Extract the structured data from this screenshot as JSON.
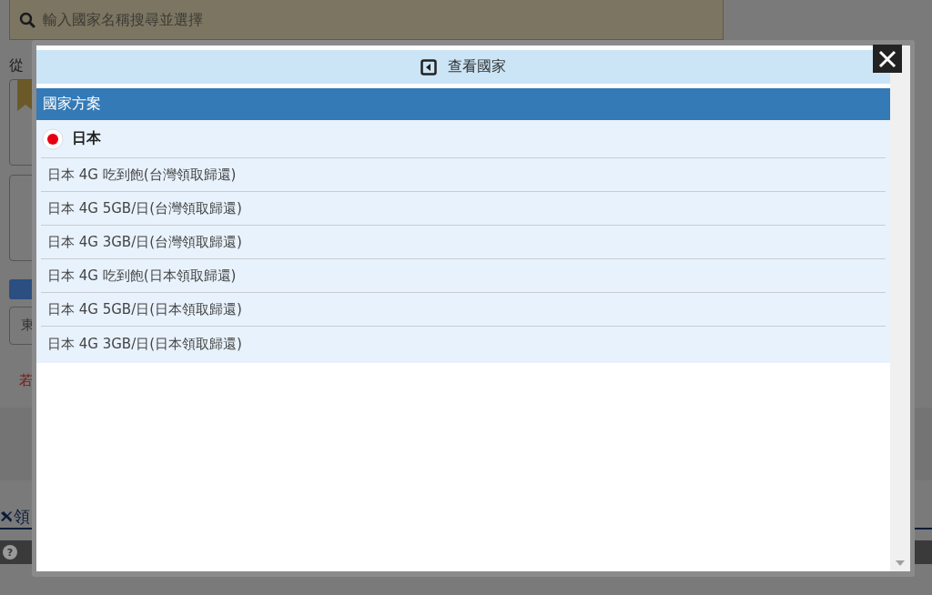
{
  "background": {
    "search": {
      "placeholder": "輸入國家名稱搜尋並選擇"
    },
    "label": "從",
    "field_value": "東",
    "notice": "若",
    "section_link": "領",
    "help": "?"
  },
  "dialog": {
    "title": "查看國家",
    "section": "國家方案",
    "country": {
      "name": "日本"
    },
    "plans": [
      {
        "name": "日本 4G 吃到飽(台灣領取歸還)"
      },
      {
        "name": "日本 4G 5GB/日(台灣領取歸還)"
      },
      {
        "name": "日本 4G 3GB/日(台灣領取歸還)"
      },
      {
        "name": "日本 4G 吃到飽(日本領取歸還)"
      },
      {
        "name": "日本 4G 5GB/日(日本領取歸還)"
      },
      {
        "name": "日本 4G 3GB/日(日本領取歸還)"
      }
    ]
  }
}
